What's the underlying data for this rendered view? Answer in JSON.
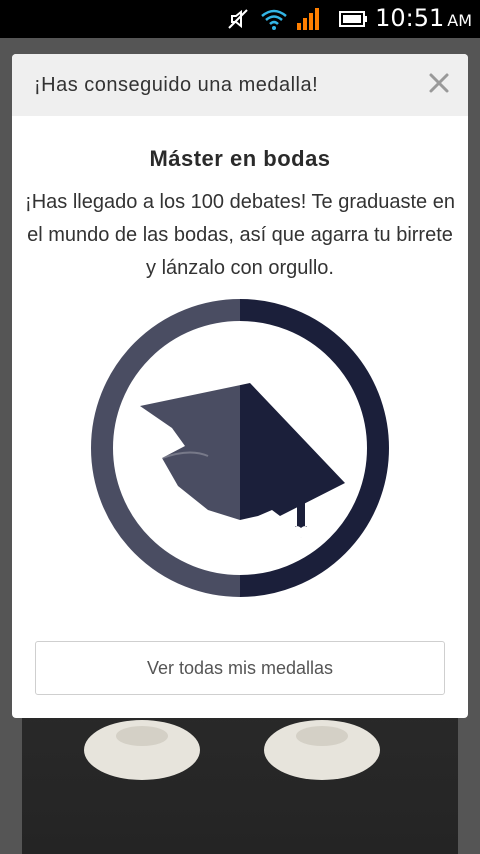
{
  "status_bar": {
    "time": "10:51",
    "ampm": "AM",
    "icons": [
      "mute-icon",
      "wifi-icon",
      "signal-icon",
      "battery-icon"
    ]
  },
  "modal": {
    "title": "¡Has conseguido una medalla!",
    "medal": {
      "name": "Máster en bodas",
      "description": "¡Has llegado a los 100 debates! Te graduaste en el mundo de las bodas, así que agarra tu birrete y lánzalo con orgullo.",
      "icon": "graduation-cap-icon"
    },
    "cta_label": "Ver todas mis medallas"
  },
  "colors": {
    "navy": "#1b1f3a",
    "slate": "#4a4d62",
    "signal": "#ff7f00",
    "wifi": "#33b5e5"
  }
}
